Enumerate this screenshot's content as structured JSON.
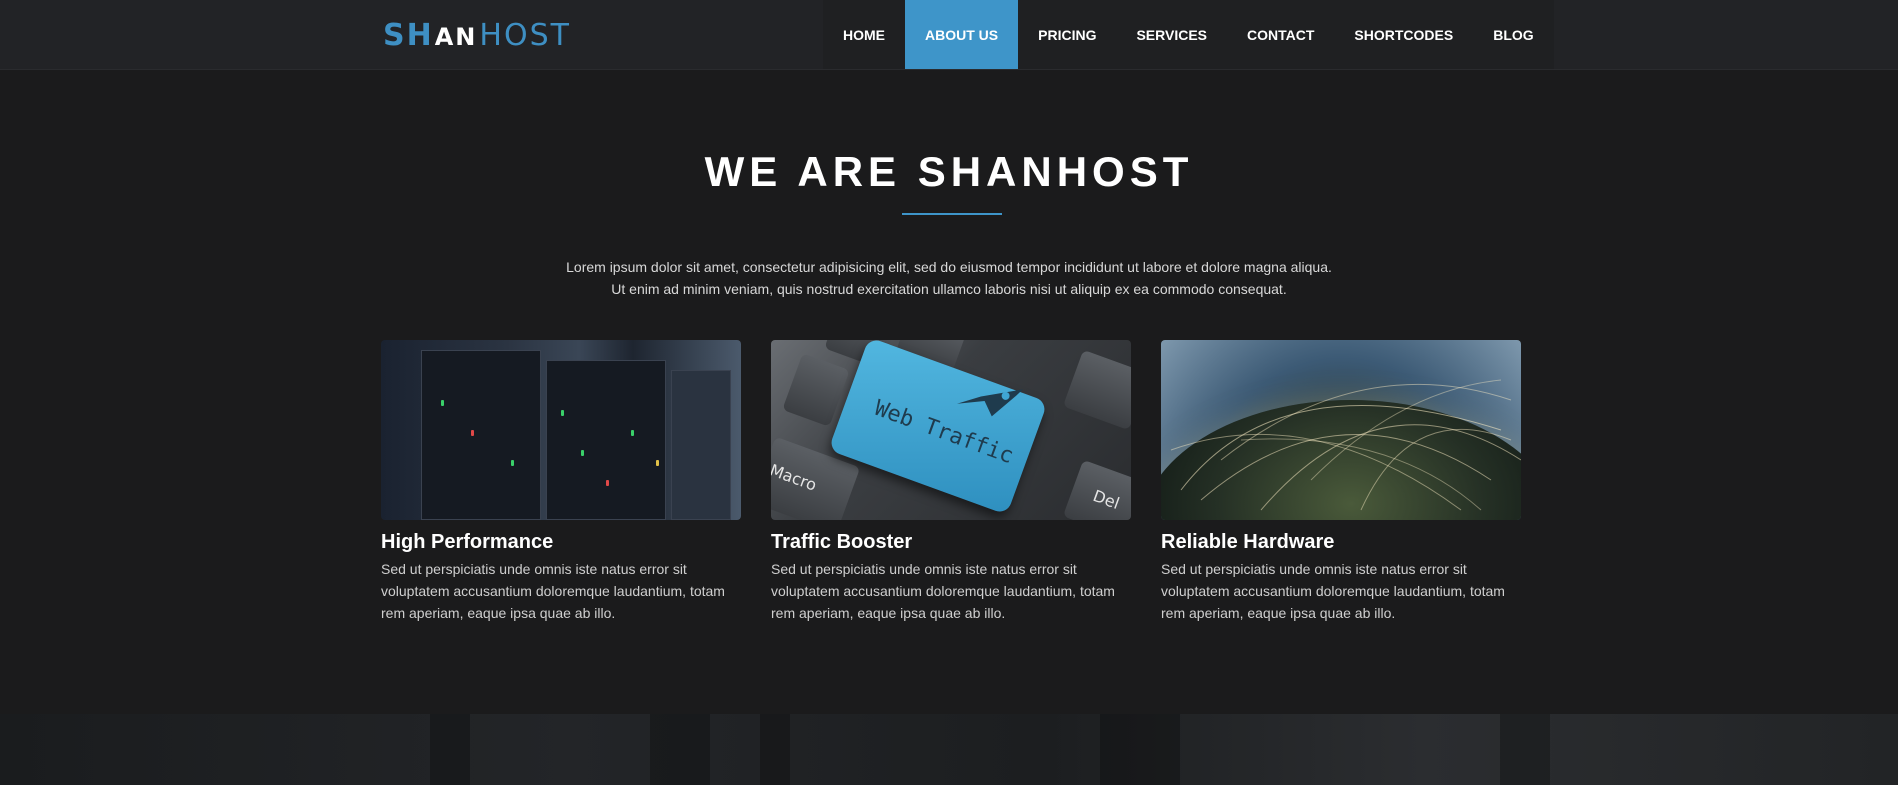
{
  "header": {
    "logo": {
      "part1": "SH",
      "part2": "AN",
      "part3": "HOST"
    },
    "nav": [
      {
        "label": "HOME"
      },
      {
        "label": "ABOUT US"
      },
      {
        "label": "PRICING"
      },
      {
        "label": "SERVICES"
      },
      {
        "label": "CONTACT"
      },
      {
        "label": "SHORTCODES"
      },
      {
        "label": "BLOG"
      }
    ],
    "active_item": "ABOUT US"
  },
  "intro": {
    "title": "WE ARE SHANHOST",
    "line1": "Lorem ipsum dolor sit amet, consectetur adipisicing elit, sed do eiusmod tempor incididunt ut labore et dolore magna aliqua.",
    "line2": "Ut enim ad minim veniam, quis nostrud exercitation ullamco laboris nisi ut aliquip ex ea commodo consequat."
  },
  "features": [
    {
      "image": "server-rack-photo",
      "title": "High Performance",
      "text": "Sed ut perspiciatis unde omnis iste natus error sit voluptatem accusantium doloremque laudantium, totam rem aperiam, eaque ipsa quae ab illo."
    },
    {
      "image": "keyboard-photo",
      "title": "Traffic Booster",
      "text": "Sed ut perspiciatis unde omnis iste natus error sit voluptatem accusantium doloremque laudantium, totam rem aperiam, eaque ipsa quae ab illo.",
      "key_text": "Web Traffic",
      "key_labels": [
        "Macro",
        "Del"
      ]
    },
    {
      "image": "globe-network-photo",
      "title": "Reliable Hardware",
      "text": "Sed ut perspiciatis unde omnis iste natus error sit voluptatem accusantium doloremque laudantium, totam rem aperiam, eaque ipsa quae ab illo."
    }
  ],
  "colors": {
    "accent": "#3e95c9",
    "background": "#1b1b1c",
    "header": "#222326"
  }
}
